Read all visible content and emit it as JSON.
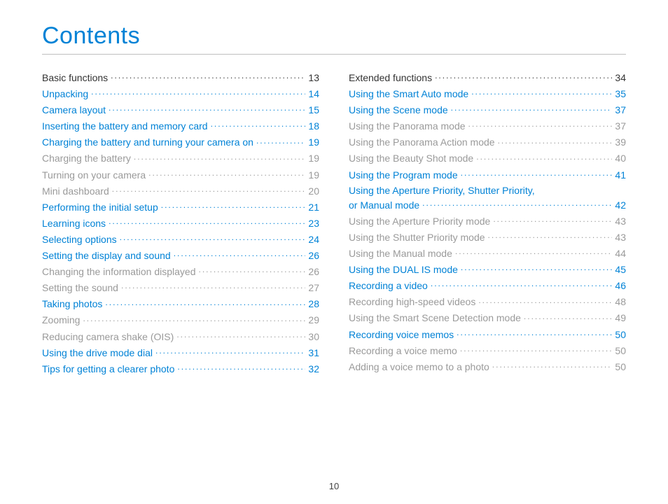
{
  "title": "Contents",
  "page_number": "10",
  "columns": [
    [
      {
        "label": "Basic functions",
        "page": "13",
        "style": "section"
      },
      {
        "label": "Unpacking",
        "page": "14",
        "style": "link"
      },
      {
        "label": "Camera layout",
        "page": "15",
        "style": "link"
      },
      {
        "label": "Inserting the battery and memory card",
        "page": "18",
        "style": "link"
      },
      {
        "label": "Charging the battery and turning your camera on",
        "page": "19",
        "style": "link"
      },
      {
        "label": "Charging the battery",
        "page": "19",
        "style": "sub"
      },
      {
        "label": "Turning on your camera",
        "page": "19",
        "style": "sub"
      },
      {
        "label": "Mini dashboard",
        "page": "20",
        "style": "sub"
      },
      {
        "label": "Performing the initial setup",
        "page": "21",
        "style": "link"
      },
      {
        "label": "Learning icons",
        "page": "23",
        "style": "link"
      },
      {
        "label": "Selecting options",
        "page": "24",
        "style": "link"
      },
      {
        "label": "Setting the display and sound",
        "page": "26",
        "style": "link"
      },
      {
        "label": "Changing the information displayed",
        "page": "26",
        "style": "sub"
      },
      {
        "label": "Setting the sound",
        "page": "27",
        "style": "sub"
      },
      {
        "label": "Taking photos",
        "page": "28",
        "style": "link"
      },
      {
        "label": "Zooming",
        "page": "29",
        "style": "sub"
      },
      {
        "label": "Reducing camera shake (OIS)",
        "page": "30",
        "style": "sub"
      },
      {
        "label": "Using the drive mode dial",
        "page": "31",
        "style": "link"
      },
      {
        "label": "Tips for getting a clearer photo",
        "page": "32",
        "style": "link"
      }
    ],
    [
      {
        "label": "Extended functions",
        "page": "34",
        "style": "section"
      },
      {
        "label": "Using the Smart Auto mode",
        "page": "35",
        "style": "link"
      },
      {
        "label": "Using the Scene mode",
        "page": "37",
        "style": "link"
      },
      {
        "label": "Using the Panorama mode",
        "page": "37",
        "style": "sub"
      },
      {
        "label": "Using the Panorama Action mode",
        "page": "39",
        "style": "sub"
      },
      {
        "label": "Using the Beauty Shot mode",
        "page": "40",
        "style": "sub"
      },
      {
        "label": "Using the Program mode",
        "page": "41",
        "style": "link"
      },
      {
        "label": "Using the Aperture Priority, Shutter Priority,",
        "label2": "or Manual mode",
        "page": "42",
        "style": "link",
        "wrap": true
      },
      {
        "label": "Using the Aperture Priority mode",
        "page": "43",
        "style": "sub"
      },
      {
        "label": "Using the Shutter Priority mode",
        "page": "43",
        "style": "sub"
      },
      {
        "label": "Using the Manual mode",
        "page": "44",
        "style": "sub"
      },
      {
        "label": "Using the DUAL IS mode",
        "page": "45",
        "style": "link"
      },
      {
        "label": "Recording a video",
        "page": "46",
        "style": "link"
      },
      {
        "label": "Recording high-speed videos",
        "page": "48",
        "style": "sub"
      },
      {
        "label": "Using the Smart Scene Detection mode",
        "page": "49",
        "style": "sub"
      },
      {
        "label": "Recording voice memos",
        "page": "50",
        "style": "link"
      },
      {
        "label": "Recording a voice memo",
        "page": "50",
        "style": "sub"
      },
      {
        "label": "Adding a voice memo to a photo",
        "page": "50",
        "style": "sub"
      }
    ]
  ]
}
